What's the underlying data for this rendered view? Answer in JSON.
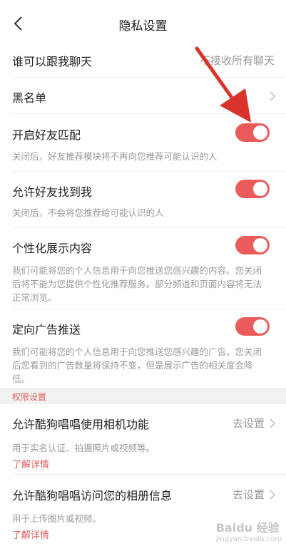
{
  "header": {
    "title": "隐私设置"
  },
  "rows": {
    "chat": {
      "label": "谁可以跟我聊天",
      "value": "不接收所有聊天"
    },
    "blacklist": {
      "label": "黑名单"
    },
    "friend_match": {
      "label": "开启好友匹配",
      "desc": "关闭后，好友推荐模块将不再向您推荐可能认识的人",
      "on": true
    },
    "find_me": {
      "label": "允许好友找到我",
      "desc": "关闭后，不会将您推荐给可能认识的人",
      "on": true
    },
    "personal_content": {
      "label": "个性化展示内容",
      "desc": "我们可能将您的个人信息用于向您推送您感兴趣的内容。您关闭后将不能为您提供个性化推荐服务。部分频道和页面内容将无法正常浏览。",
      "on": true
    },
    "ad_push": {
      "label": "定向广告推送",
      "desc": "我们可能将您的个人信息用于向您推送您感兴趣的广告。您关闭后您看到的广告数量将保持不变，但是展示广告的相关度会降低。",
      "on": true
    }
  },
  "permissions": {
    "section_title": "权限设置",
    "camera": {
      "label": "允许酷狗唱唱使用相机功能",
      "action": "去设置",
      "desc": "用于实名认证、拍摄照片或视频等。",
      "link": "了解详情"
    },
    "album": {
      "label": "允许酷狗唱唱访问您的相册信息",
      "action": "去设置",
      "desc": "用于上传图片或视频。",
      "link": "了解详情"
    }
  },
  "watermark": {
    "brand": "Baidu 经验",
    "url": "jingyan.baidu.com"
  },
  "colors": {
    "accent": "#ec5b5b",
    "annotation_arrow": "#d9342b"
  },
  "icons": {
    "back": "chevron-left-icon",
    "forward": "chevron-right-icon",
    "annotation": "arrow-annotation-icon"
  }
}
